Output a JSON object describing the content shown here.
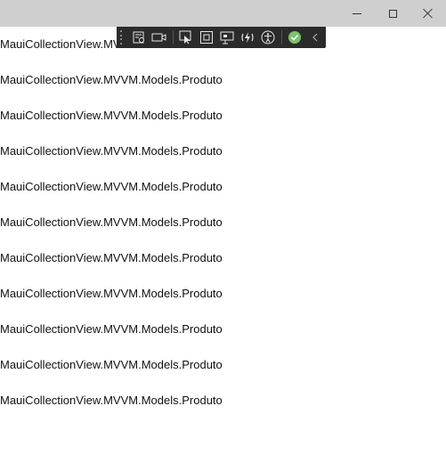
{
  "window": {
    "controls": {
      "minimize_icon": "minimize-icon",
      "maximize_icon": "maximize-icon",
      "close_icon": "close-icon"
    }
  },
  "debug_toolbar": {
    "icons": [
      "live-visual-tree-icon",
      "record-icon",
      "select-element-icon",
      "display-layout-adorners-icon",
      "track-focus-icon",
      "hot-reload-icon",
      "accessibility-checker-icon",
      "binding-failures-ok-icon",
      "collapse-chevron-icon"
    ],
    "status_color": "#7cc26b",
    "background": "#2b2b2b"
  },
  "collection_view": {
    "items": [
      "MauiCollectionView.MVVM.Models.Produto",
      "MauiCollectionView.MVVM.Models.Produto",
      "MauiCollectionView.MVVM.Models.Produto",
      "MauiCollectionView.MVVM.Models.Produto",
      "MauiCollectionView.MVVM.Models.Produto",
      "MauiCollectionView.MVVM.Models.Produto",
      "MauiCollectionView.MVVM.Models.Produto",
      "MauiCollectionView.MVVM.Models.Produto",
      "MauiCollectionView.MVVM.Models.Produto",
      "MauiCollectionView.MVVM.Models.Produto",
      "MauiCollectionView.MVVM.Models.Produto"
    ]
  }
}
